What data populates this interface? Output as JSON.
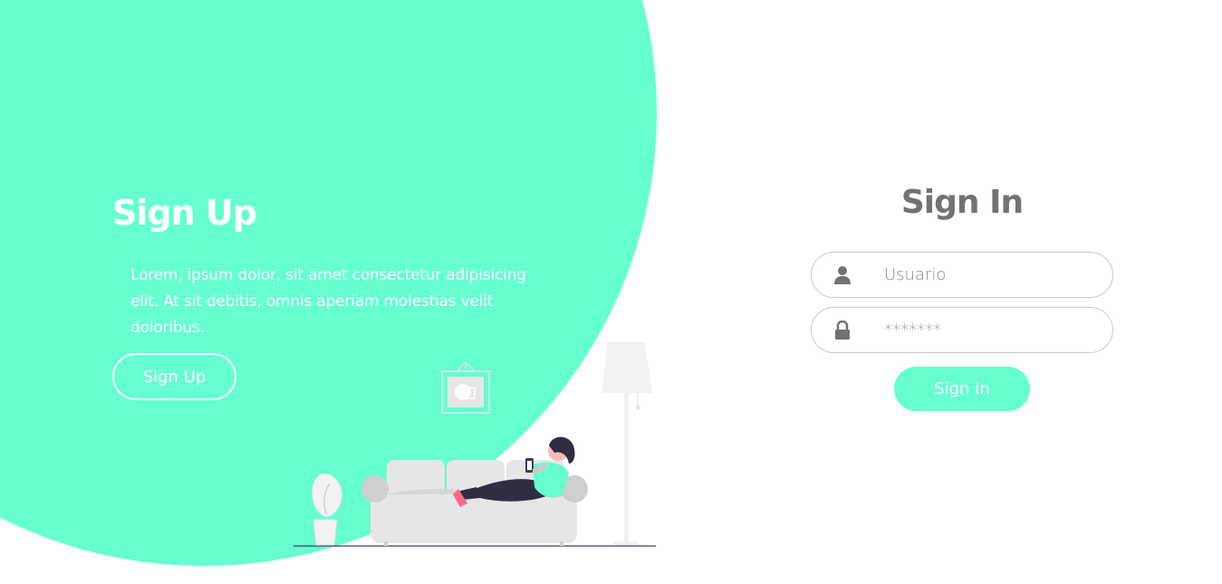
{
  "colors": {
    "accent": "#65ffd0",
    "text_on_accent": "#ffffff",
    "heading_gray": "#727272",
    "field_border": "#c9c9c9"
  },
  "signup": {
    "title": "Sign Up",
    "description": "Lorem, ipsum dolor, sit amet consectetur adipisicing elit. At sit debitis, omnis aperiam molestias velit doloribus.",
    "button_label": "Sign Up"
  },
  "signin": {
    "title": "Sign In",
    "username": {
      "icon": "user-icon",
      "placeholder": "Usuario",
      "value": ""
    },
    "password": {
      "icon": "lock-icon",
      "placeholder": "*******",
      "value": ""
    },
    "button_label": "Sign In"
  },
  "illustration": {
    "name": "person-on-sofa-illustration"
  }
}
